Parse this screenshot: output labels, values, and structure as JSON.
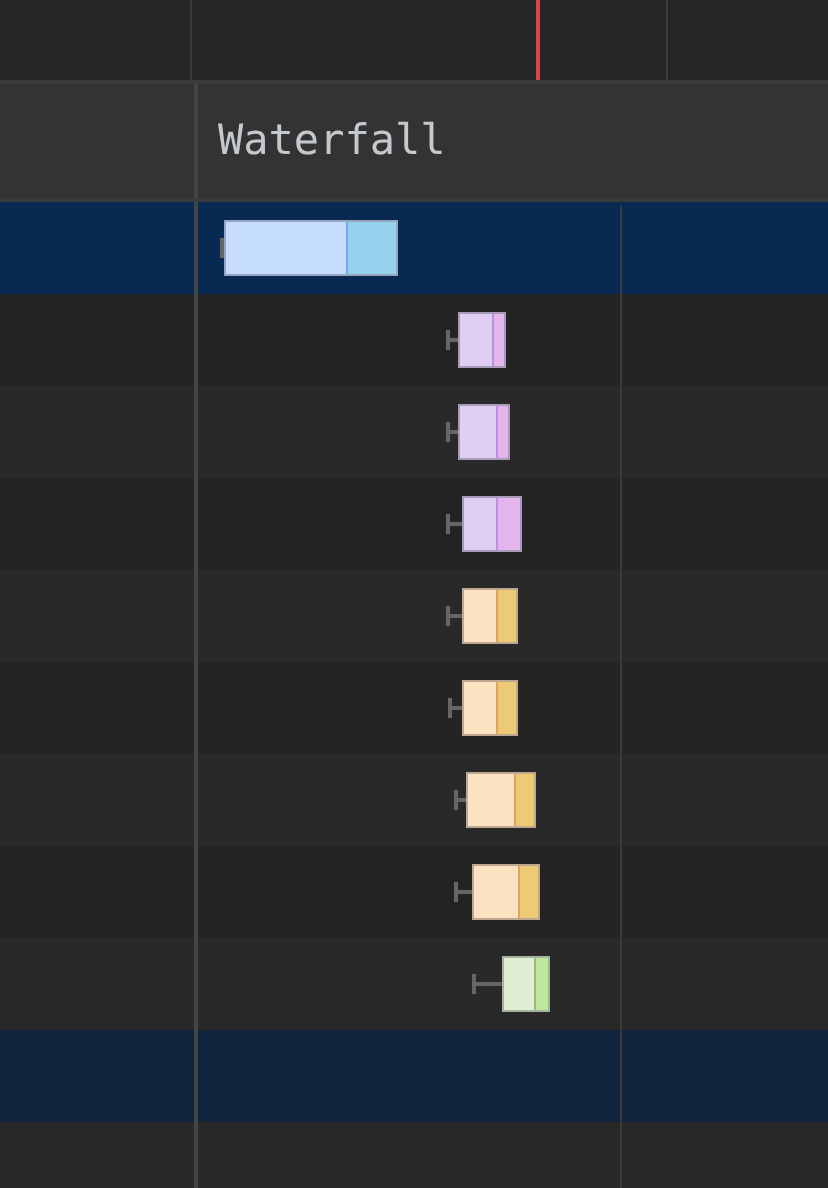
{
  "header": {
    "columns": [
      {},
      {
        "label": "Waterfall"
      }
    ]
  },
  "rows": [
    {
      "selected": true,
      "hovered": false,
      "color": "#c6dcfc"
    },
    {
      "selected": false,
      "hovered": false,
      "color": "#e0cff3"
    },
    {
      "selected": false,
      "hovered": false,
      "color": "#e0cff3"
    },
    {
      "selected": false,
      "hovered": false,
      "color": "#e0cff3"
    },
    {
      "selected": false,
      "hovered": false,
      "color": "#fde1c3"
    },
    {
      "selected": false,
      "hovered": false,
      "color": "#fde1c3"
    },
    {
      "selected": false,
      "hovered": false,
      "color": "#fde1c3"
    },
    {
      "selected": false,
      "hovered": false,
      "color": "#fde1c3"
    },
    {
      "selected": false,
      "hovered": false,
      "color": "#e0efd3"
    },
    {
      "selected": false,
      "hovered": true
    },
    {
      "selected": false,
      "hovered": false
    }
  ]
}
